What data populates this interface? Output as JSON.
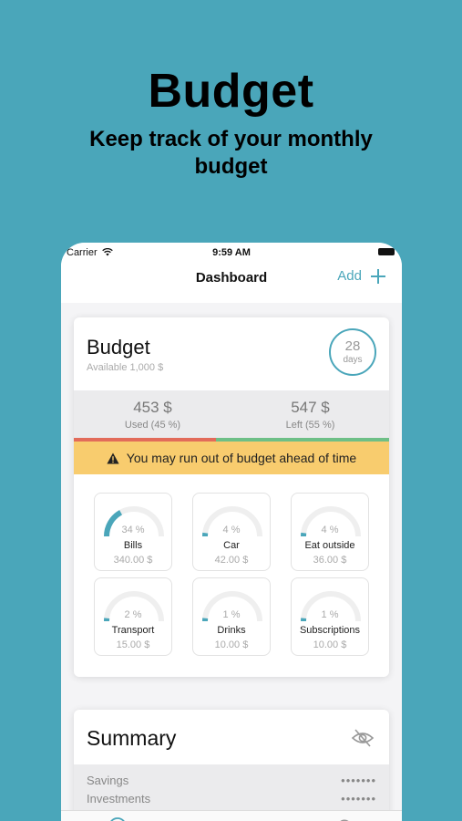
{
  "hero": {
    "title": "Budget",
    "subtitle": "Keep track of your monthly budget"
  },
  "status_bar": {
    "carrier": "Carrier",
    "time": "9:59 AM"
  },
  "nav": {
    "title": "Dashboard",
    "add_label": "Add"
  },
  "budget": {
    "title": "Budget",
    "available": "Available 1,000 $",
    "days_left": "28",
    "days_unit": "days",
    "used_value": "453 $",
    "used_label": "Used (45 %)",
    "left_value": "547 $",
    "left_label": "Left (55 %)",
    "used_fraction": 0.45,
    "warning": "You may run out of budget ahead of time"
  },
  "categories": [
    {
      "name": "Bills",
      "pct": "34 %",
      "amount": "340.00 $",
      "fraction": 0.34
    },
    {
      "name": "Car",
      "pct": "4 %",
      "amount": "42.00 $",
      "fraction": 0.04
    },
    {
      "name": "Eat outside",
      "pct": "4 %",
      "amount": "36.00 $",
      "fraction": 0.04
    },
    {
      "name": "Transport",
      "pct": "2 %",
      "amount": "15.00 $",
      "fraction": 0.02
    },
    {
      "name": "Drinks",
      "pct": "1 %",
      "amount": "10.00 $",
      "fraction": 0.01
    },
    {
      "name": "Subscriptions",
      "pct": "1 %",
      "amount": "10.00 $",
      "fraction": 0.01
    }
  ],
  "summary": {
    "title": "Summary",
    "rows": [
      {
        "label": "Savings",
        "value": "•••••••"
      },
      {
        "label": "Investments",
        "value": "•••••••"
      }
    ]
  },
  "colors": {
    "accent": "#4aa6ba",
    "used": "#e26b5a",
    "left": "#6ebf87",
    "warning": "#f8cc6e"
  },
  "icons": {
    "add": "plus-icon",
    "warning": "warning-triangle-icon",
    "hide": "eye-slash-icon",
    "wifi": "wifi-icon",
    "battery": "battery-icon"
  }
}
